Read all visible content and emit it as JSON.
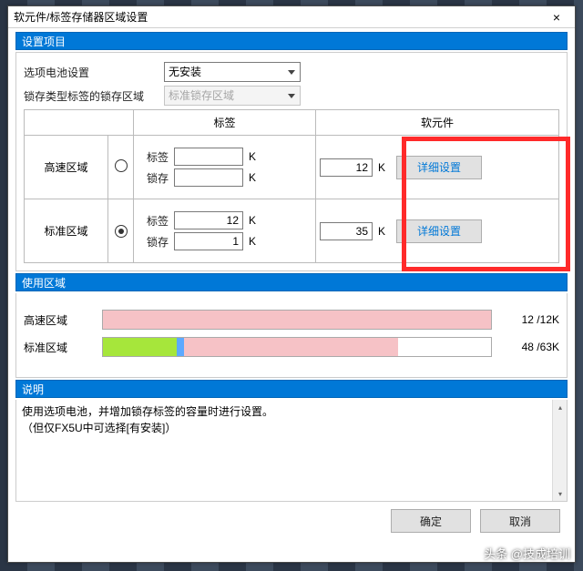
{
  "win": {
    "title": "软元件/标签存储器区域设置",
    "close": "×"
  },
  "settings": {
    "header": "设置项目",
    "battery_label": "选项电池设置",
    "battery_value": "无安装",
    "latch_label": "锁存类型标签的锁存区域",
    "latch_value": "标准锁存区域"
  },
  "table": {
    "tag_header": "标签",
    "device_header": "软元件",
    "highspeed": "高速区域",
    "standard": "标准区域",
    "tag_l": "标签",
    "latch_l": "锁存",
    "k": "K",
    "hs_tag": "",
    "hs_latch": "",
    "hs_dev": "12",
    "st_tag": "12",
    "st_latch": "1",
    "st_dev": "35",
    "detail_btn": "详细设置"
  },
  "usage": {
    "header": "使用区域",
    "hs_label": "高速区域",
    "st_label": "标准区域",
    "hs_stat": "12 /12K",
    "st_stat": "48 /63K"
  },
  "desc": {
    "header": "说明",
    "text": "使用选项电池，并增加锁存标签的容量时进行设置。\n（但仅FX5U中可选择[有安装]）"
  },
  "footer": {
    "ok": "确定",
    "cancel": "取消"
  },
  "watermark": "头条 @技成培训"
}
